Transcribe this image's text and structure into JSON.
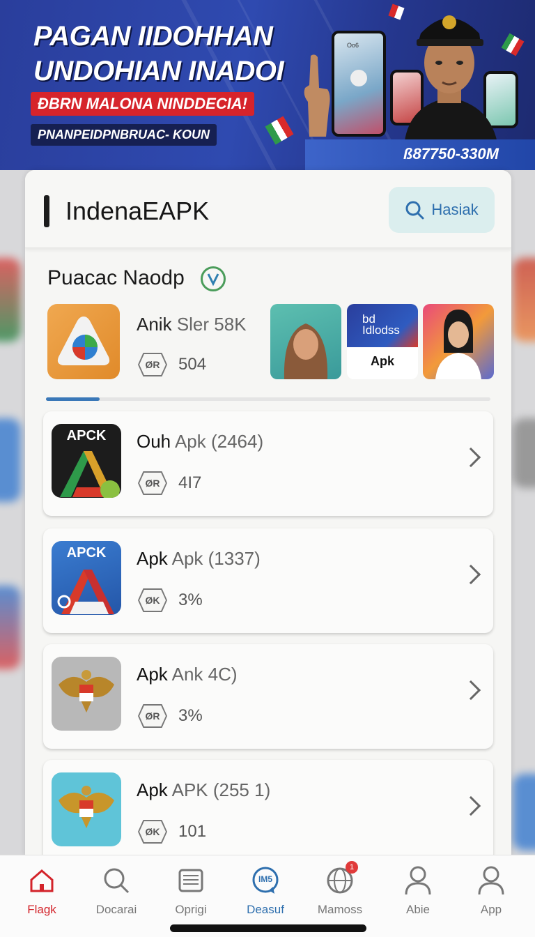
{
  "banner": {
    "title_line1": "PAGAN IIDOHHAN",
    "title_line2": "UNDOHIAN INADOI",
    "red_tag": "ÐBRN MALONA NINDDECIA!",
    "dark_tag": "PNANPEIDPNBRUAC- KOUN",
    "code": "ß87750-330M",
    "phone_text": "Oo6"
  },
  "header": {
    "title": "IndenaEAPK",
    "search_label": "Hasiak"
  },
  "featured": {
    "section_title": "Puacac Naodp",
    "app_name": "Anik",
    "app_sub": "Sler 58K",
    "badge_text": "ØR",
    "count": "504",
    "thumb2_line1": "bd",
    "thumb2_line2": "Idlodss",
    "thumb2_label": "Apk",
    "progress": 0.12
  },
  "apps": [
    {
      "icon_label": "APCK",
      "name": "Ouh",
      "sub": "Apk (2464)",
      "badge": "ØR",
      "count": "4I7"
    },
    {
      "icon_label": "APCK",
      "name": "Apk",
      "sub": "Apk (1337)",
      "badge": "ØK",
      "count": "3%"
    },
    {
      "icon_label": "",
      "name": "Apk",
      "sub": "Ank 4C)",
      "badge": "ØR",
      "count": "3%"
    },
    {
      "icon_label": "",
      "name": "Apk",
      "sub": "APK (255 1)",
      "badge": "ØK",
      "count": "101"
    }
  ],
  "nav": [
    {
      "label": "Flagk",
      "icon": "home-icon",
      "active": true
    },
    {
      "label": "Docarai",
      "icon": "search-icon"
    },
    {
      "label": "Oprigi",
      "icon": "inbox-icon"
    },
    {
      "label": "Deasuf",
      "icon": "chat-bubble-icon",
      "bubble": "IM5"
    },
    {
      "label": "Mamoss",
      "icon": "globe-icon",
      "badge": "1"
    },
    {
      "label": "Abie",
      "icon": "user-icon"
    },
    {
      "label": "App",
      "icon": "profile-icon"
    }
  ],
  "colors": {
    "accent_blue": "#2e6fae",
    "nav_active": "#d3232a",
    "banner_bg": "#2f4ab0"
  }
}
